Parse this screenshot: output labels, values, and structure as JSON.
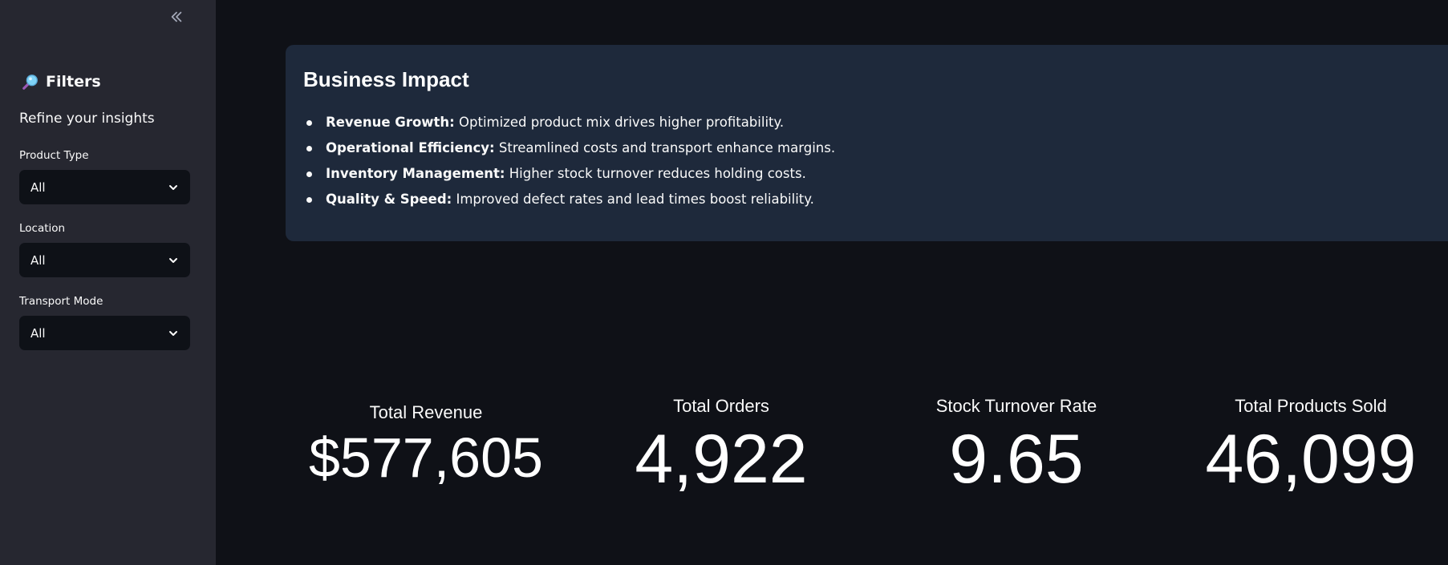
{
  "sidebar": {
    "collapse_icon": "chevrons-left-icon",
    "header_icon": "magnifying-glass-icon",
    "title": "Filters",
    "subtitle": "Refine your insights",
    "filters": [
      {
        "label": "Product Type",
        "value": "All"
      },
      {
        "label": "Location",
        "value": "All"
      },
      {
        "label": "Transport Mode",
        "value": "All"
      }
    ]
  },
  "impact": {
    "title": "Business Impact",
    "items": [
      {
        "bold": "Revenue Growth:",
        "text": " Optimized product mix drives higher profitability."
      },
      {
        "bold": "Operational Efficiency:",
        "text": " Streamlined costs and transport enhance margins."
      },
      {
        "bold": "Inventory Management:",
        "text": " Higher stock turnover reduces holding costs."
      },
      {
        "bold": "Quality & Speed:",
        "text": " Improved defect rates and lead times boost reliability."
      }
    ]
  },
  "metrics": [
    {
      "label": "Total Revenue",
      "value": "$577,605"
    },
    {
      "label": "Total Orders",
      "value": "4,922"
    },
    {
      "label": "Stock Turnover Rate",
      "value": "9.65"
    },
    {
      "label": "Total Products Sold",
      "value": "46,099"
    }
  ],
  "colors": {
    "app_background": "#0f1117",
    "sidebar_background": "#262730",
    "card_background": "#1e293b",
    "select_background": "#0e1117",
    "text": "#fafafa"
  }
}
